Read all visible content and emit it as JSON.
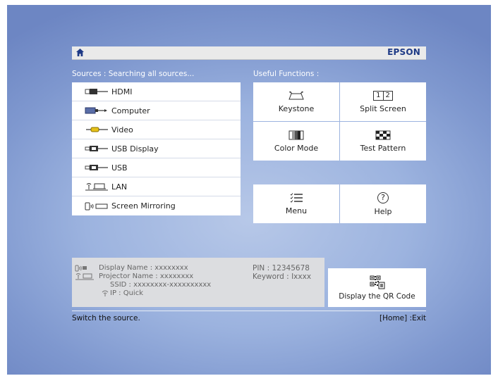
{
  "header": {
    "brand": "EPSON"
  },
  "sources": {
    "label": "Sources :  Searching all sources...",
    "items": [
      {
        "label": "HDMI",
        "icon": "hdmi-icon"
      },
      {
        "label": "Computer",
        "icon": "computer-icon"
      },
      {
        "label": "Video",
        "icon": "video-icon"
      },
      {
        "label": "USB Display",
        "icon": "usb-display-icon"
      },
      {
        "label": "USB",
        "icon": "usb-icon"
      },
      {
        "label": "LAN",
        "icon": "lan-icon"
      },
      {
        "label": "Screen Mirroring",
        "icon": "screen-mirroring-icon"
      }
    ]
  },
  "functions": {
    "label": "Useful Functions :",
    "items": [
      {
        "label": "Keystone",
        "icon": "keystone-icon"
      },
      {
        "label": "Split Screen",
        "icon": "split-screen-icon",
        "icon_text_left": "1",
        "icon_text_right": "2"
      },
      {
        "label": "Color Mode",
        "icon": "color-mode-icon"
      },
      {
        "label": "Test Pattern",
        "icon": "test-pattern-icon"
      },
      {
        "label": "Menu",
        "icon": "menu-icon"
      },
      {
        "label": "Help",
        "icon": "help-icon",
        "icon_text": "?"
      }
    ]
  },
  "info": {
    "display_name_label": "Display Name :",
    "display_name_value": "xxxxxxxx",
    "projector_name_label": "Projector Name :",
    "projector_name_value": "xxxxxxxx",
    "ssid_label": "SSID :",
    "ssid_value": "xxxxxxxx-xxxxxxxxxx",
    "ip_label": "IP :",
    "ip_value": "Quick",
    "pin_label": "PIN :",
    "pin_value": "12345678",
    "keyword_label": "Keyword :",
    "keyword_value": "Ixxxx"
  },
  "qr": {
    "label": "Display the QR Code"
  },
  "status": {
    "hint": "Switch the source.",
    "exit": "[Home] :Exit"
  },
  "colors": {
    "background": "#8fa6d8",
    "panel": "#ffffff",
    "brand": "#1e3a86"
  }
}
